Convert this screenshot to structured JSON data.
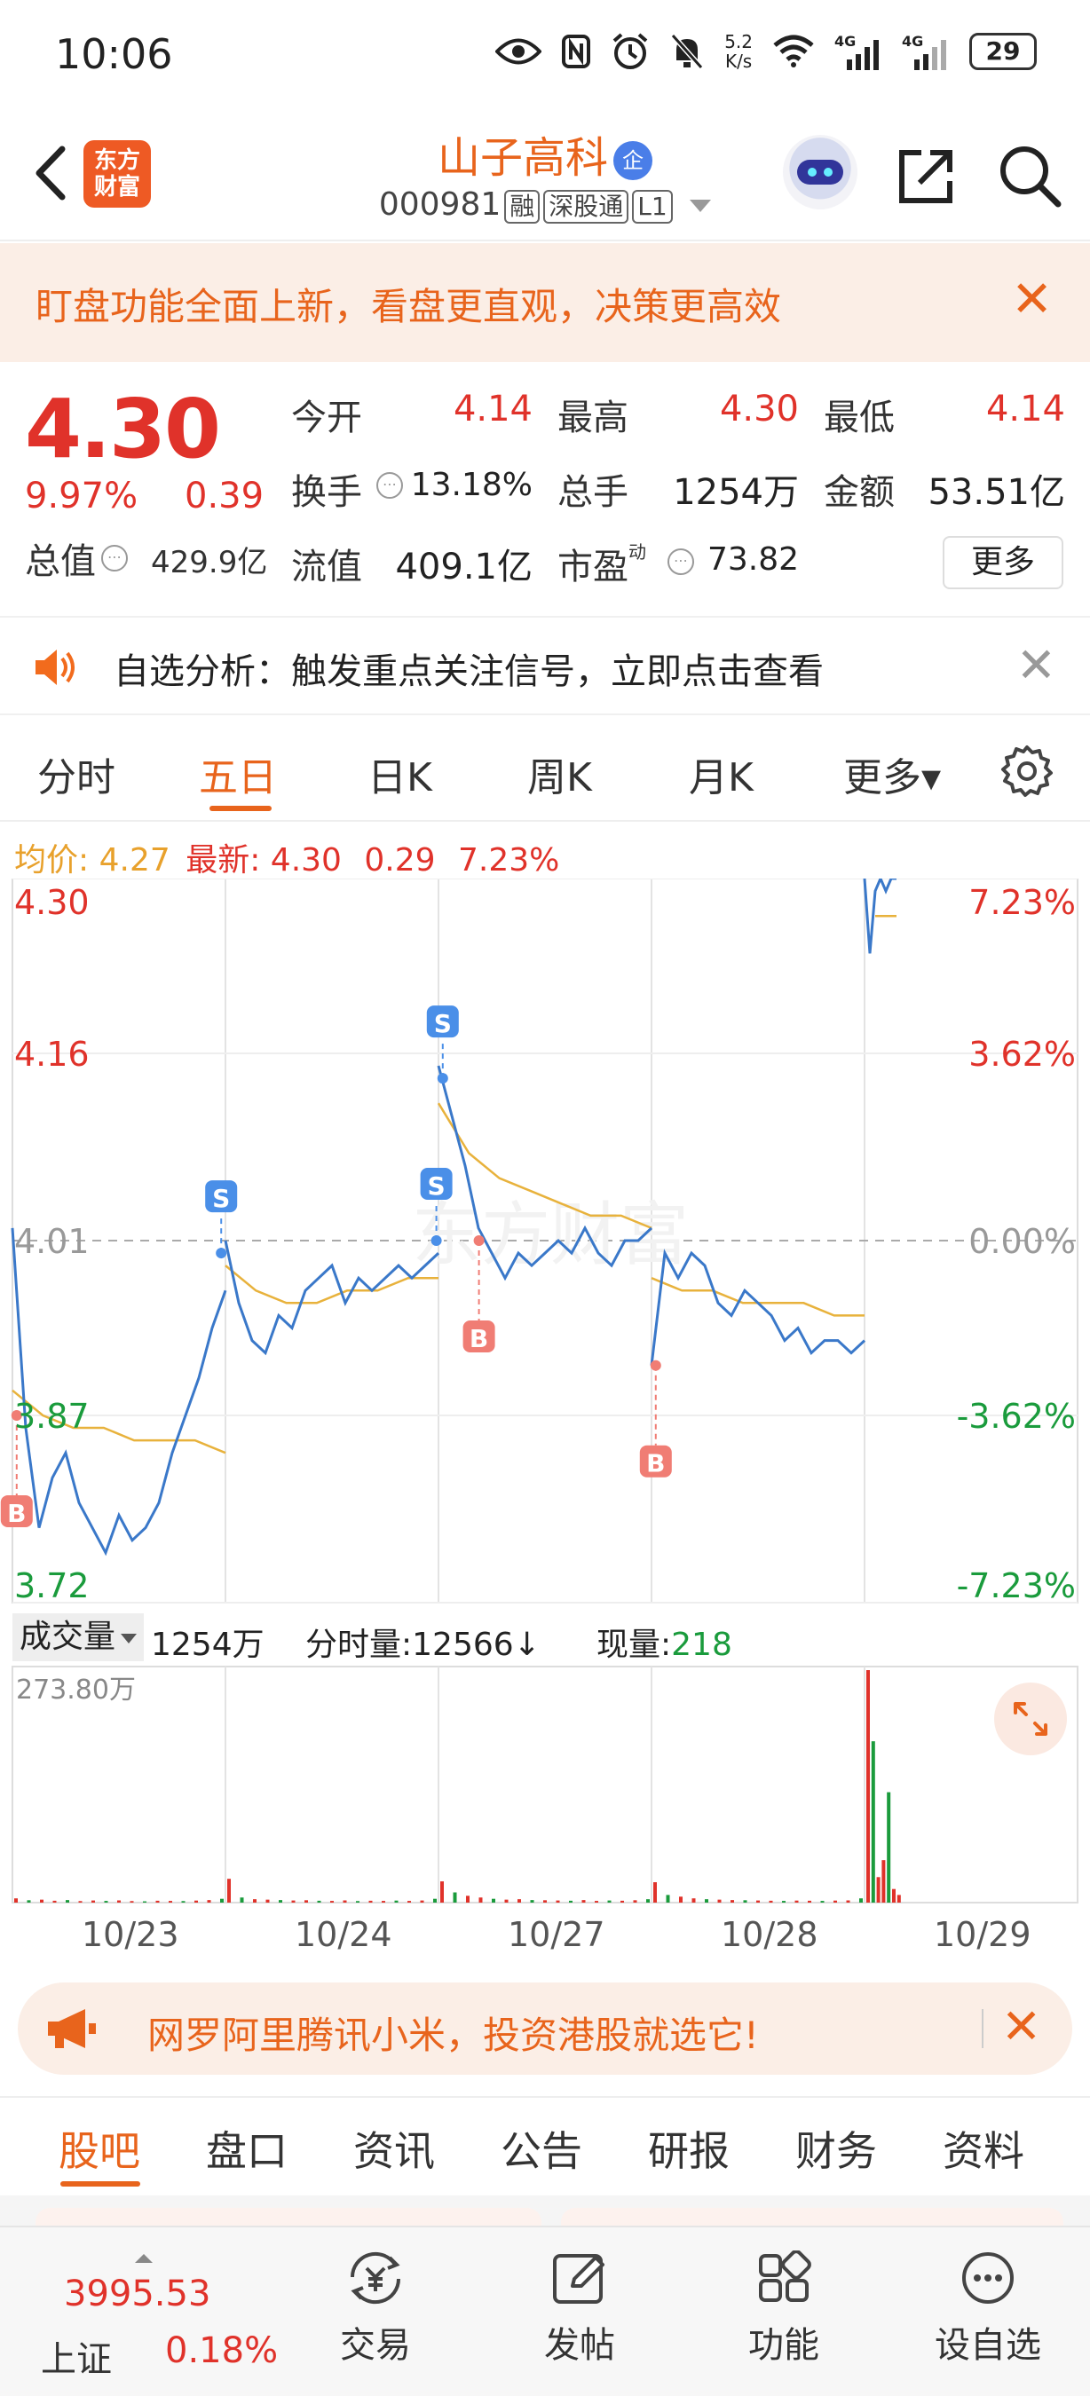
{
  "status_bar": {
    "time": "10:06",
    "icons": [
      "eye-icon",
      "nfc-icon",
      "alarm-icon",
      "mute-icon",
      "wifi-icon",
      "signal-4g-icon",
      "signal-4g-icon",
      "battery-icon"
    ],
    "net_speed_value": "5.2",
    "net_speed_unit": "K/s",
    "network_label_1": "4G",
    "network_label_2": "4G",
    "battery": "29"
  },
  "header": {
    "brand_line1": "东方",
    "brand_line2": "财富",
    "stock_name": "山子高科",
    "badge": "企",
    "stock_code": "000981",
    "tags": [
      "融",
      "深股通",
      "L1"
    ]
  },
  "promo": {
    "text": "盯盘功能全面上新，看盘更直观，决策更高效",
    "close": "✕"
  },
  "quote": {
    "price": "4.30",
    "change_pct": "9.97%",
    "change_abs": "0.39",
    "mktcap_label": "总值",
    "mktcap_value": "429.9亿",
    "fields": {
      "open_label": "今开",
      "open_value": "4.14",
      "high_label": "最高",
      "high_value": "4.30",
      "low_label": "最低",
      "low_value": "4.14",
      "turnover_label": "换手",
      "turnover_value": "13.18%",
      "volume_label": "总手",
      "volume_value": "1254万",
      "amount_label": "金额",
      "amount_value": "53.51亿",
      "float_label": "流值",
      "float_value": "409.1亿",
      "pe_label": "市盈",
      "pe_sup": "动",
      "pe_value": "73.82"
    },
    "more_button": "更多"
  },
  "notice": {
    "text": "自选分析：触发重点关注信号，立即点击查看",
    "close": "✕"
  },
  "period_tabs": {
    "items": [
      "分时",
      "五日",
      "日K",
      "周K",
      "月K",
      "更多▾"
    ],
    "active_index": 1
  },
  "chart_summary": {
    "avg_label": "均价:",
    "avg_value": "4.27",
    "latest_label": "最新:",
    "latest_value": "4.30",
    "latest_chg": "0.29",
    "latest_pct": "7.23%"
  },
  "volume_header": {
    "selector": "成交量",
    "total": "1254万",
    "tick_label": "分时量:",
    "tick_value": "12566",
    "tick_arrow": "↓",
    "now_label": "现量:",
    "now_value": "218"
  },
  "chart_data": [
    {
      "type": "line",
      "title": "",
      "x_categories": [
        "10/23",
        "10/24",
        "10/27",
        "10/28",
        "10/29"
      ],
      "y_tick_labels_left": [
        "4.30",
        "4.16",
        "4.01",
        "3.87",
        "3.72"
      ],
      "y_tick_labels_right": [
        "7.23%",
        "3.62%",
        "0.00%",
        "-3.62%",
        "-7.23%"
      ],
      "ylim": [
        3.72,
        4.3
      ],
      "baseline": 4.01,
      "colors": {
        "price": "#3a78c9",
        "average": "#e8b23c",
        "up": "#e0322a",
        "down": "#1a9b3c"
      },
      "series": [
        {
          "id": "price",
          "values_per_day": [
            [
              4.02,
              3.86,
              3.78,
              3.82,
              3.84,
              3.8,
              3.78,
              3.76,
              3.79,
              3.77,
              3.78,
              3.8,
              3.84,
              3.87,
              3.9,
              3.94,
              3.97
            ],
            [
              4.01,
              3.96,
              3.93,
              3.92,
              3.95,
              3.94,
              3.97,
              3.98,
              3.99,
              3.96,
              3.98,
              3.97,
              3.98,
              3.99,
              3.98,
              3.99,
              4.0
            ],
            [
              4.15,
              4.11,
              4.07,
              4.02,
              4.0,
              3.98,
              4.0,
              3.99,
              4.0,
              4.01,
              4.0,
              4.02,
              4.0,
              3.99,
              4.01,
              4.01,
              4.02
            ],
            [
              3.91,
              4.0,
              3.98,
              4.0,
              3.99,
              3.96,
              3.95,
              3.97,
              3.96,
              3.95,
              3.93,
              3.94,
              3.92,
              3.93,
              3.93,
              3.92,
              3.93
            ],
            [
              4.3,
              4.24,
              4.29,
              4.3,
              4.29,
              4.3,
              4.3
            ]
          ]
        },
        {
          "id": "average",
          "values_per_day": [
            [
              3.89,
              3.87,
              3.86,
              3.86,
              3.85,
              3.85,
              3.85,
              3.84
            ],
            [
              3.99,
              3.97,
              3.96,
              3.96,
              3.97,
              3.97,
              3.98,
              3.98
            ],
            [
              4.12,
              4.08,
              4.06,
              4.05,
              4.04,
              4.03,
              4.03,
              4.02
            ],
            [
              3.98,
              3.97,
              3.97,
              3.96,
              3.96,
              3.96,
              3.95,
              3.95
            ],
            [
              4.27,
              4.27
            ]
          ]
        }
      ],
      "markers": [
        {
          "label": "B",
          "color": "#f07d74",
          "day": 0,
          "at": 0.02,
          "price": 3.87
        },
        {
          "label": "S",
          "color": "#4a8fe8",
          "day": 0,
          "at": 0.98,
          "price": 4.0
        },
        {
          "label": "S",
          "color": "#4a8fe8",
          "day": 1,
          "at": 0.99,
          "price": 4.01
        },
        {
          "label": "S",
          "color": "#4a8fe8",
          "day": 2,
          "at": 0.02,
          "price": 4.14
        },
        {
          "label": "B",
          "color": "#f07d74",
          "day": 2,
          "at": 0.19,
          "price": 4.01
        },
        {
          "label": "B",
          "color": "#f07d74",
          "day": 3,
          "at": 0.02,
          "price": 3.91
        }
      ]
    },
    {
      "type": "bar",
      "title": "成交量",
      "y_tick_label": "273.80万",
      "ymax": 2738000,
      "x_categories": [
        "10/23",
        "10/24",
        "10/27",
        "10/28",
        "10/29"
      ],
      "series": [
        {
          "name": "volume",
          "values_per_day": [
            [
              50000,
              28000,
              35000,
              22000,
              30000,
              18000,
              25000,
              20000,
              26000,
              18000,
              15000,
              22000,
              20000,
              18000,
              24000,
              30000,
              45000
            ],
            [
              280000,
              60000,
              40000,
              35000,
              30000,
              25000,
              28000,
              22000,
              20000,
              26000,
              18000,
              22000,
              20000,
              24000,
              20000,
              25000,
              45000
            ],
            [
              250000,
              120000,
              80000,
              60000,
              45000,
              35000,
              40000,
              30000,
              28000,
              25000,
              22000,
              30000,
              20000,
              25000,
              22000,
              28000,
              40000
            ],
            [
              240000,
              90000,
              70000,
              50000,
              40000,
              35000,
              30000,
              28000,
              25000,
              22000,
              20000,
              24000,
              22000,
              20000,
              24000,
              26000,
              50000
            ],
            [
              2738000,
              1900000,
              300000,
              500000,
              1300000,
              160000,
              90000
            ]
          ]
        }
      ]
    }
  ],
  "watermark": "东方财富",
  "ad_banner": {
    "text": "网罗阿里腾讯小米，投资港股就选它!",
    "close": "✕"
  },
  "info_tabs": {
    "items": [
      "股吧",
      "盘口",
      "资讯",
      "公告",
      "研报",
      "财务",
      "资料"
    ],
    "active_index": 0
  },
  "bottom_nav": {
    "index_value": "3995.53",
    "index_name": "上证",
    "index_change": "0.18%",
    "items": [
      {
        "label": "交易",
        "icon": "trade-icon"
      },
      {
        "label": "发帖",
        "icon": "post-icon"
      },
      {
        "label": "功能",
        "icon": "function-grid-icon"
      },
      {
        "label": "设自选",
        "icon": "add-watchlist-icon"
      }
    ]
  }
}
